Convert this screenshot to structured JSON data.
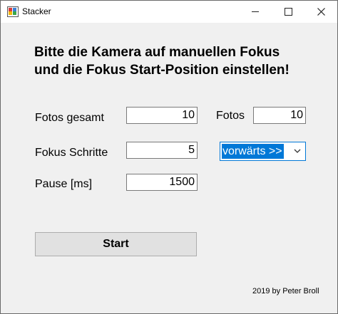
{
  "window": {
    "title": "Stacker"
  },
  "heading": {
    "line1": "Bitte die Kamera auf manuellen Fokus",
    "line2": "und die Fokus Start-Position einstellen!"
  },
  "form": {
    "fotos_gesamt": {
      "label": "Fotos gesamt",
      "value": "10"
    },
    "fotos": {
      "label": "Fotos",
      "value": "10"
    },
    "fokus_schritte": {
      "label": "Fokus Schritte",
      "value": "5"
    },
    "direction": {
      "selected": "vorwärts >>"
    },
    "pause": {
      "label": "Pause [ms]",
      "value": "1500"
    }
  },
  "start_button": {
    "label": "Start"
  },
  "footer": {
    "credit": "2019 by Peter Broll"
  },
  "colors": {
    "selection": "#0078d7",
    "window_bg": "#f0f0f0",
    "button_bg": "#e1e1e1"
  },
  "icons": [
    "app-icon",
    "minimize-icon",
    "maximize-icon",
    "close-icon",
    "chevron-down-icon"
  ]
}
